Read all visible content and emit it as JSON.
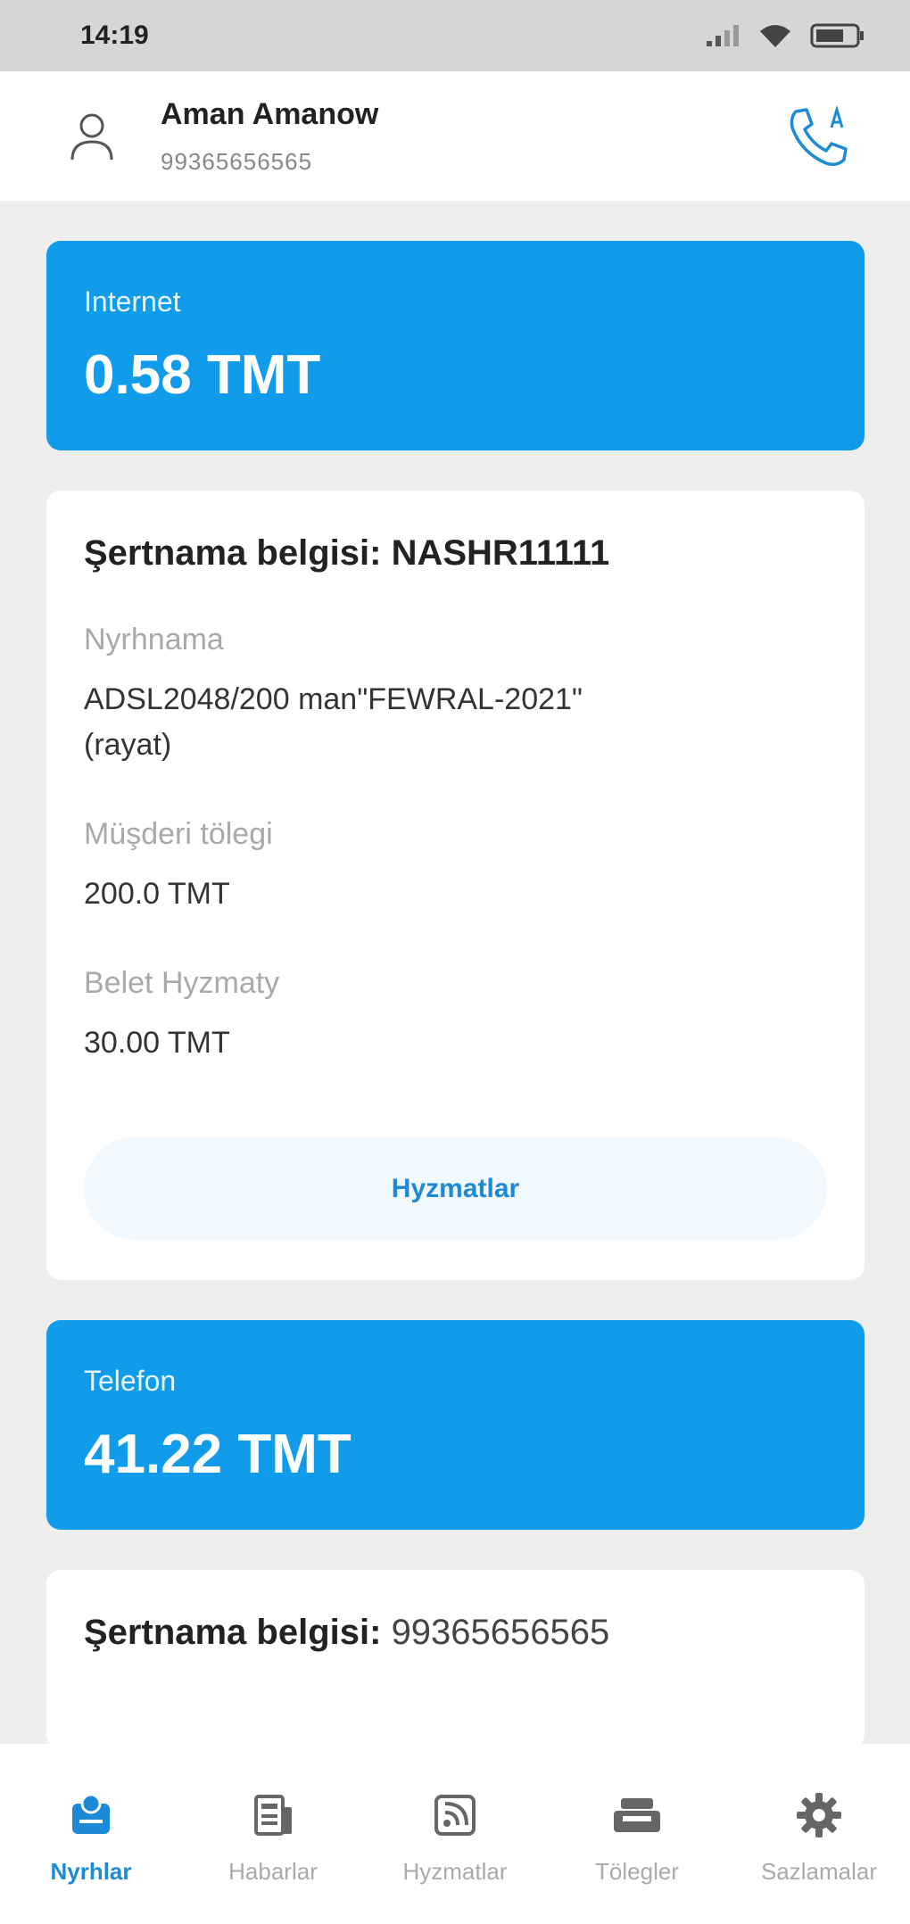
{
  "status_bar": {
    "time": "14:19"
  },
  "header": {
    "name": "Aman Amanow",
    "phone": "99365656565"
  },
  "internet": {
    "label": "Internet",
    "amount": "0.58 TMT",
    "contract_label": "Şertnama belgisi:",
    "contract_value": "NASHR11111",
    "tariff_label": "Nyrhnama",
    "tariff_value": "ADSL2048/200 man\"FEWRAL-2021\" (rayat)",
    "customer_pay_label": "Müşderi tölegi",
    "customer_pay_value": "200.0 TMT",
    "free_service_label": "Belet Hyzmaty",
    "free_service_value": "30.00 TMT",
    "services_button": "Hyzmatlar"
  },
  "telefon": {
    "label": "Telefon",
    "amount": "41.22 TMT",
    "contract_label": "Şertnama belgisi:",
    "contract_value": "99365656565"
  },
  "bottom_nav": {
    "items": [
      {
        "label": "Nyrhlar",
        "icon": "accounts-icon",
        "active": true
      },
      {
        "label": "Habarlar",
        "icon": "news-icon",
        "active": false
      },
      {
        "label": "Hyzmatlar",
        "icon": "services-icon",
        "active": false
      },
      {
        "label": "Tölegler",
        "icon": "payments-icon",
        "active": false
      },
      {
        "label": "Sazlamalar",
        "icon": "settings-icon",
        "active": false
      }
    ]
  },
  "colors": {
    "accent": "#109ceb",
    "active_nav": "#1c8ad6"
  }
}
